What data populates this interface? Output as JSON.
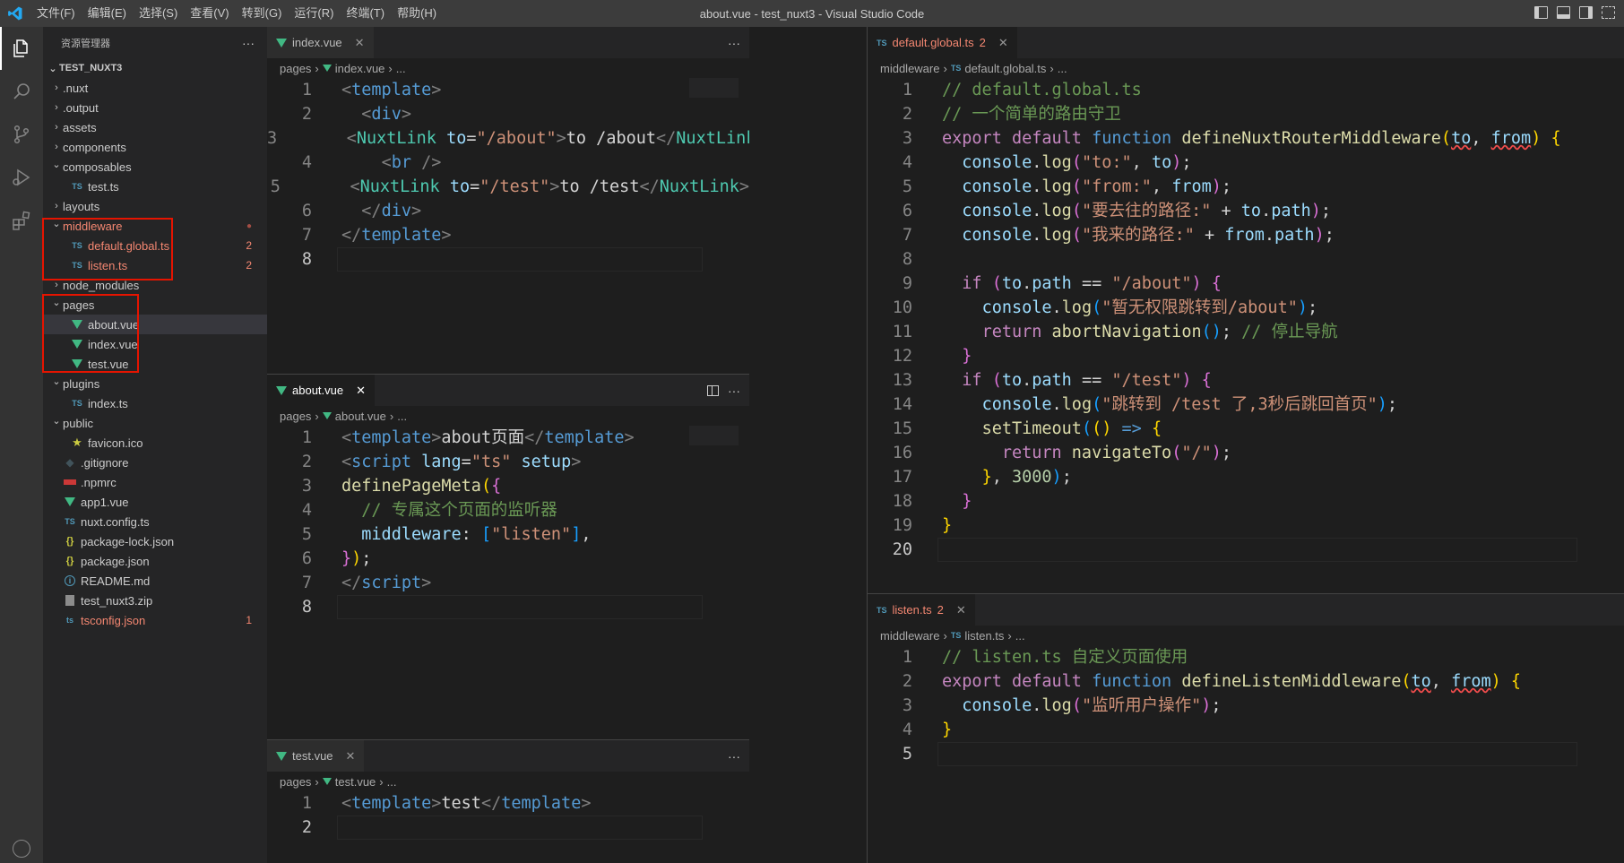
{
  "app": {
    "window_title": "about.vue - test_nuxt3 - Visual Studio Code",
    "menu": [
      "文件(F)",
      "编辑(E)",
      "选择(S)",
      "查看(V)",
      "转到(G)",
      "运行(R)",
      "终端(T)",
      "帮助(H)"
    ]
  },
  "activity_bar": {
    "icons": [
      "files-icon",
      "search-icon",
      "source-control-icon",
      "run-debug-icon",
      "extensions-icon"
    ]
  },
  "sidebar": {
    "title": "资源管理器",
    "more": "···",
    "folder": "TEST_NUXT3",
    "items": [
      {
        "label": ".nuxt",
        "depth": 1,
        "type": "folder",
        "open": false
      },
      {
        "label": ".output",
        "depth": 1,
        "type": "folder",
        "open": false
      },
      {
        "label": "assets",
        "depth": 1,
        "type": "folder",
        "open": false
      },
      {
        "label": "components",
        "depth": 1,
        "type": "folder",
        "open": false
      },
      {
        "label": "composables",
        "depth": 1,
        "type": "folder",
        "open": true
      },
      {
        "label": "test.ts",
        "depth": 2,
        "type": "ts"
      },
      {
        "label": "layouts",
        "depth": 1,
        "type": "folder",
        "open": false
      },
      {
        "label": "middleware",
        "depth": 1,
        "type": "folder",
        "open": true,
        "error": true,
        "dot": "●"
      },
      {
        "label": "default.global.ts",
        "depth": 2,
        "type": "ts",
        "error": true,
        "badge": "2"
      },
      {
        "label": "listen.ts",
        "depth": 2,
        "type": "ts",
        "error": true,
        "badge": "2"
      },
      {
        "label": "node_modules",
        "depth": 1,
        "type": "folder",
        "open": false
      },
      {
        "label": "pages",
        "depth": 1,
        "type": "folder",
        "open": true
      },
      {
        "label": "about.vue",
        "depth": 2,
        "type": "vue",
        "selected": true
      },
      {
        "label": "index.vue",
        "depth": 2,
        "type": "vue"
      },
      {
        "label": "test.vue",
        "depth": 2,
        "type": "vue"
      },
      {
        "label": "plugins",
        "depth": 1,
        "type": "folder",
        "open": true
      },
      {
        "label": "index.ts",
        "depth": 2,
        "type": "ts"
      },
      {
        "label": "public",
        "depth": 1,
        "type": "folder",
        "open": true
      },
      {
        "label": "favicon.ico",
        "depth": 2,
        "type": "star"
      },
      {
        "label": ".gitignore",
        "depth": 1,
        "type": "git"
      },
      {
        "label": ".npmrc",
        "depth": 1,
        "type": "npm"
      },
      {
        "label": "app1.vue",
        "depth": 1,
        "type": "vue"
      },
      {
        "label": "nuxt.config.ts",
        "depth": 1,
        "type": "ts"
      },
      {
        "label": "package-lock.json",
        "depth": 1,
        "type": "json"
      },
      {
        "label": "package.json",
        "depth": 1,
        "type": "json"
      },
      {
        "label": "README.md",
        "depth": 1,
        "type": "info"
      },
      {
        "label": "test_nuxt3.zip",
        "depth": 1,
        "type": "zip"
      },
      {
        "label": "tsconfig.json",
        "depth": 1,
        "type": "tsjson",
        "error": true,
        "badge": "1"
      }
    ]
  },
  "editors": {
    "index": {
      "tab": "index.vue",
      "breadcrumb": [
        "pages",
        "index.vue",
        "..."
      ],
      "line_numbers": [
        "1",
        "2",
        "3",
        "4",
        "5",
        "6",
        "7",
        "8"
      ]
    },
    "about": {
      "tab": "about.vue",
      "breadcrumb": [
        "pages",
        "about.vue",
        "..."
      ],
      "line_numbers": [
        "1",
        "2",
        "3",
        "4",
        "5",
        "6",
        "7",
        "8"
      ]
    },
    "test": {
      "tab": "test.vue",
      "breadcrumb": [
        "pages",
        "test.vue",
        "..."
      ],
      "line_numbers": [
        "1",
        "2"
      ]
    },
    "global": {
      "tab": "default.global.ts",
      "tab_badge": "2",
      "breadcrumb": [
        "middleware",
        "default.global.ts",
        "..."
      ],
      "line_numbers": [
        "1",
        "2",
        "3",
        "4",
        "5",
        "6",
        "7",
        "8",
        "9",
        "10",
        "11",
        "12",
        "13",
        "14",
        "15",
        "16",
        "17",
        "18",
        "19",
        "20"
      ]
    },
    "listen": {
      "tab": "listen.ts",
      "tab_badge": "2",
      "breadcrumb": [
        "middleware",
        "listen.ts",
        "..."
      ],
      "line_numbers": [
        "1",
        "2",
        "3",
        "4",
        "5"
      ]
    }
  },
  "code": {
    "index": [
      [
        [
          "tgp",
          "<"
        ],
        [
          "tg",
          "template"
        ],
        [
          "tgp",
          ">"
        ]
      ],
      [
        [
          "plain",
          "  "
        ],
        [
          "tgp",
          "<"
        ],
        [
          "tg",
          "div"
        ],
        [
          "tgp",
          ">"
        ]
      ],
      [
        [
          "plain",
          "    "
        ],
        [
          "tgp",
          "<"
        ],
        [
          "cn",
          "NuxtLink"
        ],
        [
          "plain",
          " "
        ],
        [
          "vr",
          "to"
        ],
        [
          "plain",
          "="
        ],
        [
          "st",
          "\"/about\""
        ],
        [
          "tgp",
          ">"
        ],
        [
          "plain",
          "to /about"
        ],
        [
          "tgp",
          "</"
        ],
        [
          "cn",
          "NuxtLink"
        ],
        [
          "tgp",
          ">"
        ]
      ],
      [
        [
          "plain",
          "    "
        ],
        [
          "tgp",
          "<"
        ],
        [
          "tg",
          "br"
        ],
        [
          "plain",
          " "
        ],
        [
          "tgp",
          "/>"
        ]
      ],
      [
        [
          "plain",
          "    "
        ],
        [
          "tgp",
          "<"
        ],
        [
          "cn",
          "NuxtLink"
        ],
        [
          "plain",
          " "
        ],
        [
          "vr",
          "to"
        ],
        [
          "plain",
          "="
        ],
        [
          "st",
          "\"/test\""
        ],
        [
          "tgp",
          ">"
        ],
        [
          "plain",
          "to /test"
        ],
        [
          "tgp",
          "</"
        ],
        [
          "cn",
          "NuxtLink"
        ],
        [
          "tgp",
          ">"
        ]
      ],
      [
        [
          "plain",
          "  "
        ],
        [
          "tgp",
          "</"
        ],
        [
          "tg",
          "div"
        ],
        [
          "tgp",
          ">"
        ]
      ],
      [
        [
          "tgp",
          "</"
        ],
        [
          "tg",
          "template"
        ],
        [
          "tgp",
          ">"
        ]
      ],
      []
    ],
    "about": [
      [
        [
          "tgp",
          "<"
        ],
        [
          "tg",
          "template"
        ],
        [
          "tgp",
          ">"
        ],
        [
          "plain",
          "about页面"
        ],
        [
          "tgp",
          "</"
        ],
        [
          "tg",
          "template"
        ],
        [
          "tgp",
          ">"
        ]
      ],
      [
        [
          "tgp",
          "<"
        ],
        [
          "tg",
          "script"
        ],
        [
          "plain",
          " "
        ],
        [
          "vr",
          "lang"
        ],
        [
          "plain",
          "="
        ],
        [
          "st",
          "\"ts\""
        ],
        [
          "plain",
          " "
        ],
        [
          "vr",
          "setup"
        ],
        [
          "tgp",
          ">"
        ]
      ],
      [
        [
          "fn",
          "definePageMeta"
        ],
        [
          "p1",
          "("
        ],
        [
          "p2",
          "{"
        ]
      ],
      [
        [
          "plain",
          "  "
        ],
        [
          "cm",
          "// 专属这个页面的监听器"
        ]
      ],
      [
        [
          "plain",
          "  "
        ],
        [
          "vr",
          "middleware"
        ],
        [
          "plain",
          ": "
        ],
        [
          "p3",
          "["
        ],
        [
          "st",
          "\"listen\""
        ],
        [
          "p3",
          "]"
        ],
        [
          "plain",
          ","
        ]
      ],
      [
        [
          "p2",
          "}"
        ],
        [
          "p1",
          ")"
        ],
        [
          "plain",
          ";"
        ]
      ],
      [
        [
          "tgp",
          "</"
        ],
        [
          "tg",
          "script"
        ],
        [
          "tgp",
          ">"
        ]
      ],
      []
    ],
    "test": [
      [
        [
          "tgp",
          "<"
        ],
        [
          "tg",
          "template"
        ],
        [
          "tgp",
          ">"
        ],
        [
          "plain",
          "test"
        ],
        [
          "tgp",
          "</"
        ],
        [
          "tg",
          "template"
        ],
        [
          "tgp",
          ">"
        ]
      ],
      []
    ],
    "global": [
      [
        [
          "cm",
          "// default.global.ts"
        ]
      ],
      [
        [
          "cm",
          "// 一个简单的路由守卫"
        ]
      ],
      [
        [
          "kw",
          "export"
        ],
        [
          "plain",
          " "
        ],
        [
          "kw",
          "default"
        ],
        [
          "plain",
          " "
        ],
        [
          "k",
          "function"
        ],
        [
          "plain",
          " "
        ],
        [
          "fn",
          "defineNuxtRouterMiddleware"
        ],
        [
          "p1",
          "("
        ],
        [
          "vrs",
          "to"
        ],
        [
          "plain",
          ", "
        ],
        [
          "vrs",
          "from"
        ],
        [
          "p1",
          ")"
        ],
        [
          "plain",
          " "
        ],
        [
          "p1",
          "{"
        ]
      ],
      [
        [
          "plain",
          "  "
        ],
        [
          "vr",
          "console"
        ],
        [
          "plain",
          "."
        ],
        [
          "fn",
          "log"
        ],
        [
          "p2",
          "("
        ],
        [
          "st",
          "\"to:\""
        ],
        [
          "plain",
          ", "
        ],
        [
          "vr",
          "to"
        ],
        [
          "p2",
          ")"
        ],
        [
          "plain",
          ";"
        ]
      ],
      [
        [
          "plain",
          "  "
        ],
        [
          "vr",
          "console"
        ],
        [
          "plain",
          "."
        ],
        [
          "fn",
          "log"
        ],
        [
          "p2",
          "("
        ],
        [
          "st",
          "\"from:\""
        ],
        [
          "plain",
          ", "
        ],
        [
          "vr",
          "from"
        ],
        [
          "p2",
          ")"
        ],
        [
          "plain",
          ";"
        ]
      ],
      [
        [
          "plain",
          "  "
        ],
        [
          "vr",
          "console"
        ],
        [
          "plain",
          "."
        ],
        [
          "fn",
          "log"
        ],
        [
          "p2",
          "("
        ],
        [
          "st",
          "\"要去往的路径:\""
        ],
        [
          "plain",
          " + "
        ],
        [
          "vr",
          "to"
        ],
        [
          "plain",
          "."
        ],
        [
          "vr",
          "path"
        ],
        [
          "p2",
          ")"
        ],
        [
          "plain",
          ";"
        ]
      ],
      [
        [
          "plain",
          "  "
        ],
        [
          "vr",
          "console"
        ],
        [
          "plain",
          "."
        ],
        [
          "fn",
          "log"
        ],
        [
          "p2",
          "("
        ],
        [
          "st",
          "\"我来的路径:\""
        ],
        [
          "plain",
          " + "
        ],
        [
          "vr",
          "from"
        ],
        [
          "plain",
          "."
        ],
        [
          "vr",
          "path"
        ],
        [
          "p2",
          ")"
        ],
        [
          "plain",
          ";"
        ]
      ],
      [],
      [
        [
          "plain",
          "  "
        ],
        [
          "kw",
          "if"
        ],
        [
          "plain",
          " "
        ],
        [
          "p2",
          "("
        ],
        [
          "vr",
          "to"
        ],
        [
          "plain",
          "."
        ],
        [
          "vr",
          "path"
        ],
        [
          "plain",
          " == "
        ],
        [
          "st",
          "\"/about\""
        ],
        [
          "p2",
          ")"
        ],
        [
          "plain",
          " "
        ],
        [
          "p2",
          "{"
        ]
      ],
      [
        [
          "plain",
          "    "
        ],
        [
          "vr",
          "console"
        ],
        [
          "plain",
          "."
        ],
        [
          "fn",
          "log"
        ],
        [
          "p3",
          "("
        ],
        [
          "st",
          "\"暂无权限跳转到/about\""
        ],
        [
          "p3",
          ")"
        ],
        [
          "plain",
          ";"
        ]
      ],
      [
        [
          "plain",
          "    "
        ],
        [
          "kw",
          "return"
        ],
        [
          "plain",
          " "
        ],
        [
          "fn",
          "abortNavigation"
        ],
        [
          "p3",
          "()"
        ],
        [
          "plain",
          "; "
        ],
        [
          "cm",
          "// 停止导航"
        ]
      ],
      [
        [
          "plain",
          "  "
        ],
        [
          "p2",
          "}"
        ]
      ],
      [
        [
          "plain",
          "  "
        ],
        [
          "kw",
          "if"
        ],
        [
          "plain",
          " "
        ],
        [
          "p2",
          "("
        ],
        [
          "vr",
          "to"
        ],
        [
          "plain",
          "."
        ],
        [
          "vr",
          "path"
        ],
        [
          "plain",
          " == "
        ],
        [
          "st",
          "\"/test\""
        ],
        [
          "p2",
          ")"
        ],
        [
          "plain",
          " "
        ],
        [
          "p2",
          "{"
        ]
      ],
      [
        [
          "plain",
          "    "
        ],
        [
          "vr",
          "console"
        ],
        [
          "plain",
          "."
        ],
        [
          "fn",
          "log"
        ],
        [
          "p3",
          "("
        ],
        [
          "st",
          "\"跳转到 /test 了,3秒后跳回首页\""
        ],
        [
          "p3",
          ")"
        ],
        [
          "plain",
          ";"
        ]
      ],
      [
        [
          "plain",
          "    "
        ],
        [
          "fn",
          "setTimeout"
        ],
        [
          "p3",
          "("
        ],
        [
          "p1",
          "()"
        ],
        [
          "plain",
          " "
        ],
        [
          "k",
          "=>"
        ],
        [
          "plain",
          " "
        ],
        [
          "p1",
          "{"
        ]
      ],
      [
        [
          "plain",
          "      "
        ],
        [
          "kw",
          "return"
        ],
        [
          "plain",
          " "
        ],
        [
          "fn",
          "navigateTo"
        ],
        [
          "p2",
          "("
        ],
        [
          "st",
          "\"/\""
        ],
        [
          "p2",
          ")"
        ],
        [
          "plain",
          ";"
        ]
      ],
      [
        [
          "plain",
          "    "
        ],
        [
          "p1",
          "}"
        ],
        [
          "plain",
          ", "
        ],
        [
          "nm",
          "3000"
        ],
        [
          "p3",
          ")"
        ],
        [
          "plain",
          ";"
        ]
      ],
      [
        [
          "plain",
          "  "
        ],
        [
          "p2",
          "}"
        ]
      ],
      [
        [
          "p1",
          "}"
        ]
      ],
      []
    ],
    "listen": [
      [
        [
          "cm",
          "// listen.ts 自定义页面使用"
        ]
      ],
      [
        [
          "kw",
          "export"
        ],
        [
          "plain",
          " "
        ],
        [
          "kw",
          "default"
        ],
        [
          "plain",
          " "
        ],
        [
          "k",
          "function"
        ],
        [
          "plain",
          " "
        ],
        [
          "fn",
          "defineListenMiddleware"
        ],
        [
          "p1",
          "("
        ],
        [
          "vrs",
          "to"
        ],
        [
          "plain",
          ", "
        ],
        [
          "vrs",
          "from"
        ],
        [
          "p1",
          ")"
        ],
        [
          "plain",
          " "
        ],
        [
          "p1",
          "{"
        ]
      ],
      [
        [
          "plain",
          "  "
        ],
        [
          "vr",
          "console"
        ],
        [
          "plain",
          "."
        ],
        [
          "fn",
          "log"
        ],
        [
          "p2",
          "("
        ],
        [
          "st",
          "\"监听用户操作\""
        ],
        [
          "p2",
          ")"
        ],
        [
          "plain",
          ";"
        ]
      ],
      [
        [
          "p1",
          "}"
        ]
      ],
      []
    ]
  },
  "colors": {
    "accent_error": "#f48771",
    "highlight_box": "#e51400",
    "vue_green": "#41b883",
    "ts_blue": "#519aba"
  }
}
